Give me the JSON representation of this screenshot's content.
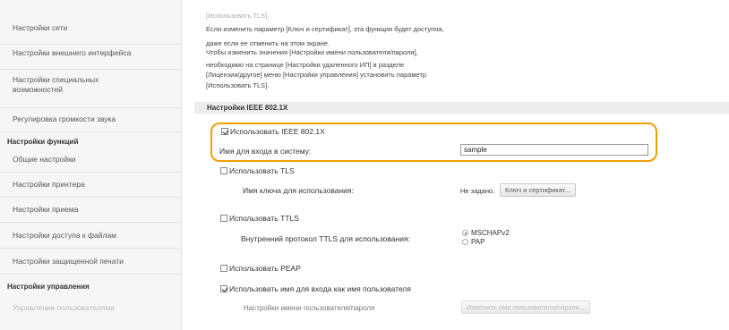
{
  "sidebar": {
    "items": [
      {
        "label": "Настройки сети",
        "faded": false
      },
      {
        "label": "Настройки внешнего интерфейса",
        "faded": false
      },
      {
        "label": "Настройки специальных возможностей",
        "faded": false
      },
      {
        "label": "Регулировка громкости звука",
        "faded": false
      }
    ],
    "section_functions": "Настройки функций",
    "function_items": [
      {
        "label": "Общие настройки"
      },
      {
        "label": "Настройки принтера"
      },
      {
        "label": "Настройки приема"
      },
      {
        "label": "Настройки доступа к файлам"
      },
      {
        "label": "Настройки защищенной печати"
      }
    ],
    "section_management": "Настройки управления",
    "management_items": [
      {
        "label": "Управление пользователями"
      }
    ]
  },
  "main": {
    "notice_lines": [
      "[Использовать TLS].",
      "Если изменить параметр [Ключ и сертификат], эта функция будет доступна,",
      "даже если ее отменить на этом экране.",
      "Чтобы изменить значения [Настройки имени пользователя/пароля],",
      "необходимо на странице [Настройки удаленного ИП] в разделе",
      "[Лицензия/другое] меню [Настройки управления] установить параметр",
      "[Использовать TLS]."
    ],
    "section_title": "Настройки IEEE 802.1X",
    "use_ieee_label": "Использовать IEEE 802.1X",
    "login_label": "Имя для входа в систему:",
    "login_value": "sample",
    "use_tls_label": "Использовать TLS",
    "key_name_label": "Имя ключа для использования:",
    "key_name_value": "Не задано.",
    "key_button_label": "Ключ и сертификат...",
    "use_ttls_label": "Использовать TTLS",
    "ttls_protocol_label": "Внутренний протокол TTLS для использования:",
    "ttls_options": [
      "MSCHAPv2",
      "PAP"
    ],
    "use_peap_label": "Использовать PEAP",
    "use_login_as_user_label": "Использовать имя для входа как имя пользователя",
    "user_settings_label": "Настройки имени пользователя/пароля",
    "change_user_button_label": "Изменить имя пользователя/пароль..."
  }
}
